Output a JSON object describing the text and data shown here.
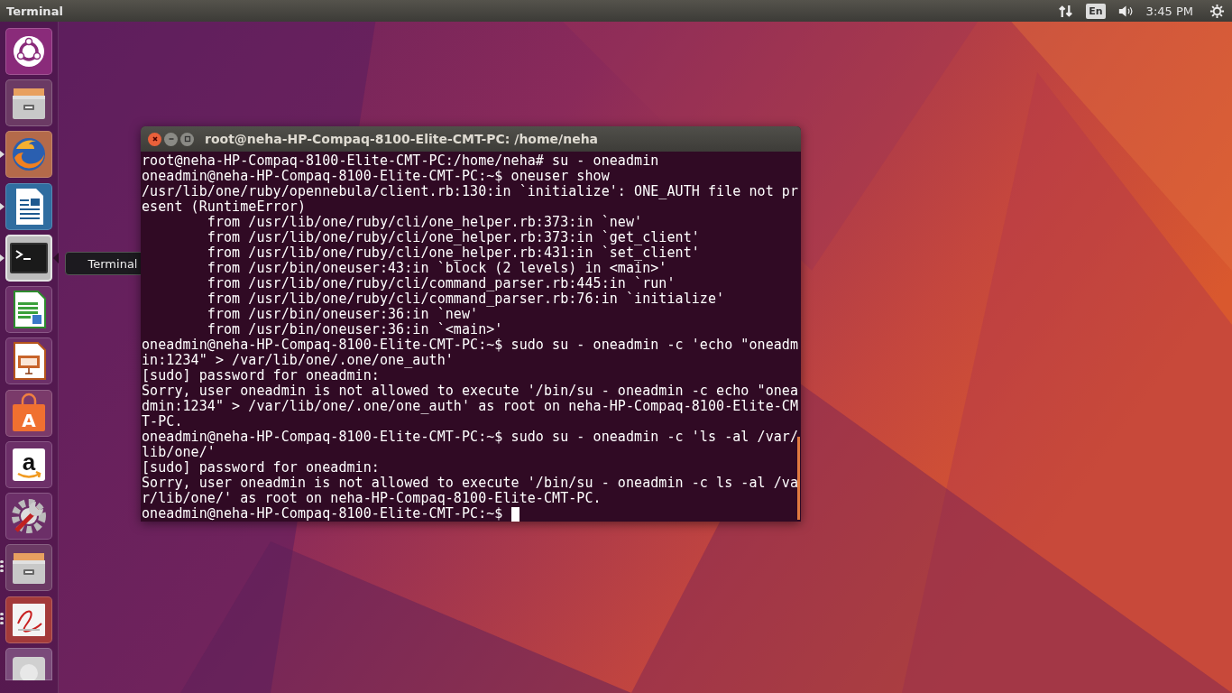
{
  "top_panel": {
    "app_title": "Terminal",
    "keyboard_layout": "En",
    "clock": "3:45 PM"
  },
  "launcher": {
    "items": [
      {
        "kind": "ubuntu",
        "running": false,
        "focused": false
      },
      {
        "kind": "files",
        "running": false,
        "focused": false
      },
      {
        "kind": "browser",
        "running": true,
        "multiple_windows": false,
        "focused": false
      },
      {
        "kind": "writer",
        "running": true,
        "multiple_windows": false,
        "focused": false
      },
      {
        "kind": "terminal",
        "running": true,
        "multiple_windows": false,
        "focused": true
      },
      {
        "kind": "calc",
        "running": false,
        "focused": false
      },
      {
        "kind": "impress",
        "running": false,
        "focused": false
      },
      {
        "kind": "store",
        "running": false,
        "focused": false,
        "glyph": "A"
      },
      {
        "kind": "amazon",
        "running": false,
        "focused": false,
        "glyph": "a"
      },
      {
        "kind": "tools",
        "running": false,
        "focused": false
      },
      {
        "kind": "files",
        "running": true,
        "multiple_windows": true,
        "focused": false
      },
      {
        "kind": "reader",
        "running": true,
        "multiple_windows": true,
        "focused": false
      },
      {
        "kind": "drive",
        "running": false,
        "focused": false
      }
    ]
  },
  "tooltip": "Terminal",
  "terminal": {
    "title": "root@neha-HP-Compaq-8100-Elite-CMT-PC: /home/neha",
    "cursor": true,
    "lines": [
      "root@neha-HP-Compaq-8100-Elite-CMT-PC:/home/neha# su - oneadmin",
      "oneadmin@neha-HP-Compaq-8100-Elite-CMT-PC:~$ oneuser show",
      "/usr/lib/one/ruby/opennebula/client.rb:130:in `initialize': ONE_AUTH file not pr",
      "esent (RuntimeError)",
      "        from /usr/lib/one/ruby/cli/one_helper.rb:373:in `new'",
      "        from /usr/lib/one/ruby/cli/one_helper.rb:373:in `get_client'",
      "        from /usr/lib/one/ruby/cli/one_helper.rb:431:in `set_client'",
      "        from /usr/bin/oneuser:43:in `block (2 levels) in <main>'",
      "        from /usr/lib/one/ruby/cli/command_parser.rb:445:in `run'",
      "        from /usr/lib/one/ruby/cli/command_parser.rb:76:in `initialize'",
      "        from /usr/bin/oneuser:36:in `new'",
      "        from /usr/bin/oneuser:36:in `<main>'",
      "oneadmin@neha-HP-Compaq-8100-Elite-CMT-PC:~$ sudo su - oneadmin -c 'echo \"oneadm",
      "in:1234\" > /var/lib/one/.one/one_auth'",
      "[sudo] password for oneadmin:",
      "Sorry, user oneadmin is not allowed to execute '/bin/su - oneadmin -c echo \"onea",
      "dmin:1234\" > /var/lib/one/.one/one_auth' as root on neha-HP-Compaq-8100-Elite-CM",
      "T-PC.",
      "oneadmin@neha-HP-Compaq-8100-Elite-CMT-PC:~$ sudo su - oneadmin -c 'ls -al /var/",
      "lib/one/'",
      "[sudo] password for oneadmin:",
      "Sorry, user oneadmin is not allowed to execute '/bin/su - oneadmin -c ls -al /va",
      "r/lib/one/' as root on neha-HP-Compaq-8100-Elite-CMT-PC.",
      "oneadmin@neha-HP-Compaq-8100-Elite-CMT-PC:~$ "
    ]
  }
}
